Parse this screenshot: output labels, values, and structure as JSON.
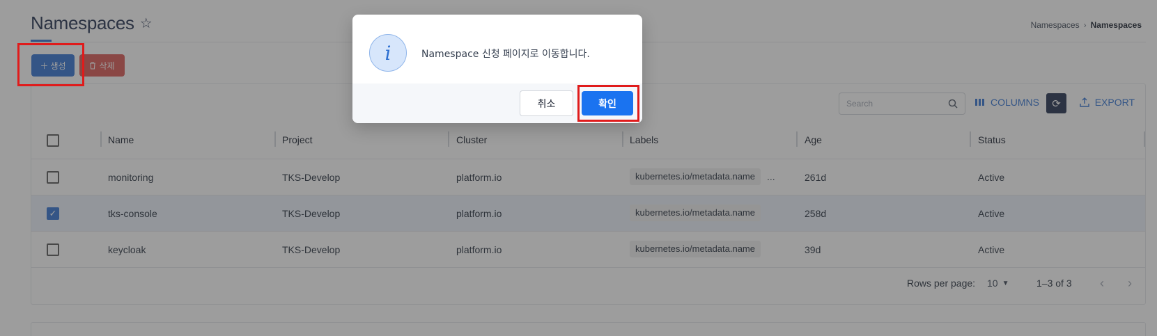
{
  "header": {
    "title": "Namespaces",
    "breadcrumb": [
      "Namespaces",
      "Namespaces"
    ]
  },
  "actions": {
    "create_label": "생성",
    "delete_label": "삭제"
  },
  "toolbar": {
    "search_placeholder": "Search",
    "columns_label": "COLUMNS",
    "export_label": "EXPORT"
  },
  "table": {
    "columns": [
      "Name",
      "Project",
      "Cluster",
      "Labels",
      "Age",
      "Status"
    ],
    "rows": [
      {
        "checked": false,
        "name": "monitoring",
        "project": "TKS-Develop",
        "cluster": "platform.io",
        "label": "kubernetes.io/metadata.name",
        "more": "...",
        "age": "261d",
        "status": "Active"
      },
      {
        "checked": true,
        "name": "tks-console",
        "project": "TKS-Develop",
        "cluster": "platform.io",
        "label": "kubernetes.io/metadata.name",
        "more": "",
        "age": "258d",
        "status": "Active"
      },
      {
        "checked": false,
        "name": "keycloak",
        "project": "TKS-Develop",
        "cluster": "platform.io",
        "label": "kubernetes.io/metadata.name",
        "more": "",
        "age": "39d",
        "status": "Active"
      }
    ]
  },
  "pagination": {
    "rows_per_page_label": "Rows per page:",
    "rows_per_page_value": "10",
    "range_text": "1–3 of 3"
  },
  "dialog": {
    "message": "Namespace 신청 페이지로 이동합니다.",
    "cancel_label": "취소",
    "confirm_label": "확인",
    "icon": "info-icon"
  },
  "colors": {
    "primary": "#2c6fd1",
    "danger": "#d9534f",
    "confirm": "#1a73f0",
    "highlight": "#e01b1b"
  }
}
